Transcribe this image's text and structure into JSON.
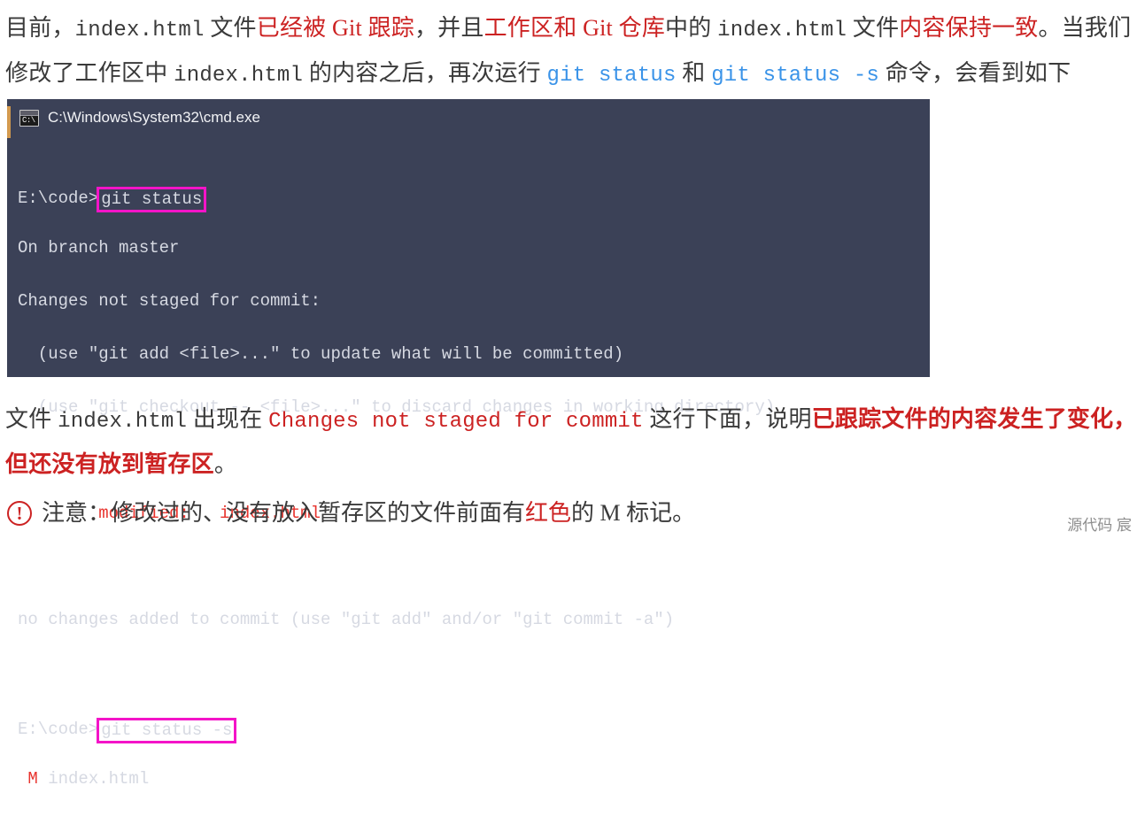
{
  "intro": {
    "seg1": "目前，",
    "code1": "index.html",
    "seg2": " 文件",
    "red1": "已经被 Git 跟踪",
    "seg3": "，并且",
    "red2": "工作区和 Git 仓库",
    "seg4": "中的 ",
    "code2": "index.html",
    "seg5": " 文件",
    "red3": "内容保持一致",
    "seg6": "。当我们修改了工作区中 ",
    "code3": "index.html",
    "seg7": " 的内容之后，再次运行 ",
    "blue1": "git status",
    "seg8": " 和 ",
    "blue2": "git status -s",
    "seg9": " 命令，会看到如下"
  },
  "terminal": {
    "title": "C:\\Windows\\System32\\cmd.exe",
    "icon_name": "cmd-exe-icon",
    "icon_glyph": "C:\\",
    "bg_color": "#3b4157",
    "accent_color": "#d39a4e",
    "highlight_color": "#f414c8",
    "text_color": "#d6d9e2",
    "error_color": "#e8342e",
    "lines": {
      "l1_prompt": "E:\\code>",
      "l1_cmd": "git status",
      "l2": "On branch master",
      "l3": "Changes not staged for commit:",
      "l4": "  (use \"git add <file>...\" to update what will be committed)",
      "l5": "  (use \"git checkout -- <file>...\" to discard changes in working directory)",
      "l6": "        modified:   index.html",
      "l7": "no changes added to commit (use \"git add\" and/or \"git commit -a\")",
      "l8_prompt": "E:\\code>",
      "l8_cmd": "git status -s",
      "l9_mark": " M",
      "l9_file": " index.html"
    }
  },
  "explain": {
    "seg1": "文件 ",
    "code1": "index.html",
    "seg2": " 出现在 ",
    "code_red": "Changes not staged for commit",
    "seg3": " 这行下面，说明",
    "bold_red": "已跟踪文件的内容发生了变化，但还没有放到暂存区",
    "seg4": "。"
  },
  "note": {
    "icon_name": "exclamation-circle-icon",
    "icon_glyph": "!",
    "seg1": "注意：修改过的、没有放入暂存区的文件前面有",
    "red1": "红色",
    "seg2": "的 M 标记。"
  },
  "watermark": {
    "text": "源代码  宸"
  },
  "colors": {
    "red": "#cc2222",
    "blue": "#3a93e8",
    "magenta": "#f414c8",
    "terminal_bg": "#3b4157"
  }
}
